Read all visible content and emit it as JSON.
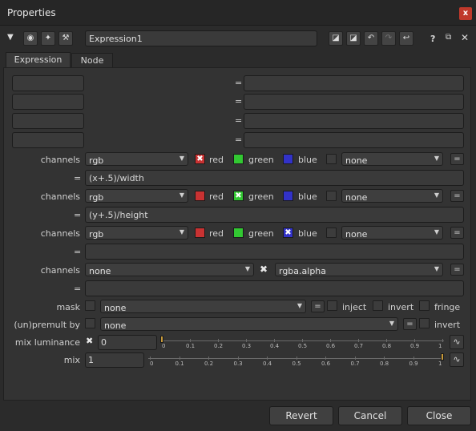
{
  "window": {
    "title": "Properties",
    "close_glyph": "x"
  },
  "toolbar": {
    "node_name": "Expression1",
    "help": "?"
  },
  "tabs": [
    {
      "label": "Expression"
    },
    {
      "label": "Node"
    }
  ],
  "eq": "=",
  "rows": [
    {
      "label": "channels",
      "combo": "rgb",
      "check1": {
        "label": "red",
        "color": "#c83232",
        "checked": true
      },
      "check2": {
        "label": "green",
        "color": "#32c832",
        "checked": false
      },
      "check3": {
        "label": "blue",
        "color": "#3232c8",
        "checked": false
      },
      "extra": "none",
      "expr": "(x+.5)/width"
    },
    {
      "label": "channels",
      "combo": "rgb",
      "check1": {
        "label": "red",
        "color": "#c83232",
        "checked": false
      },
      "check2": {
        "label": "green",
        "color": "#32c832",
        "checked": true
      },
      "check3": {
        "label": "blue",
        "color": "#3232c8",
        "checked": false
      },
      "extra": "none",
      "expr": "(y+.5)/height"
    },
    {
      "label": "channels",
      "combo": "rgb",
      "check1": {
        "label": "red",
        "color": "#c83232",
        "checked": false
      },
      "check2": {
        "label": "green",
        "color": "#32c832",
        "checked": false
      },
      "check3": {
        "label": "blue",
        "color": "#3232c8",
        "checked": true
      },
      "extra": "none",
      "expr": ""
    }
  ],
  "alpha_row": {
    "label": "channels",
    "combo": "none",
    "combo2": "rgba.alpha",
    "expr": ""
  },
  "mask": {
    "label": "mask",
    "combo": "none",
    "inject": "inject",
    "invert": "invert",
    "fringe": "fringe"
  },
  "premult": {
    "label": "(un)premult by",
    "combo": "none",
    "invert": "invert"
  },
  "mix_luminance": {
    "label": "mix luminance",
    "value": "0",
    "ticks": [
      "0",
      "0.1",
      "0.2",
      "0.3",
      "0.4",
      "0.5",
      "0.6",
      "0.7",
      "0.8",
      "0.9",
      "1"
    ]
  },
  "mix": {
    "label": "mix",
    "value": "1",
    "ticks": [
      "0",
      "0.1",
      "0.2",
      "0.3",
      "0.4",
      "0.5",
      "0.6",
      "0.7",
      "0.8",
      "0.9",
      "1"
    ]
  },
  "buttons": {
    "revert": "Revert",
    "cancel": "Cancel",
    "close": "Close"
  },
  "colors": {
    "accent_close": "#c0392b"
  }
}
